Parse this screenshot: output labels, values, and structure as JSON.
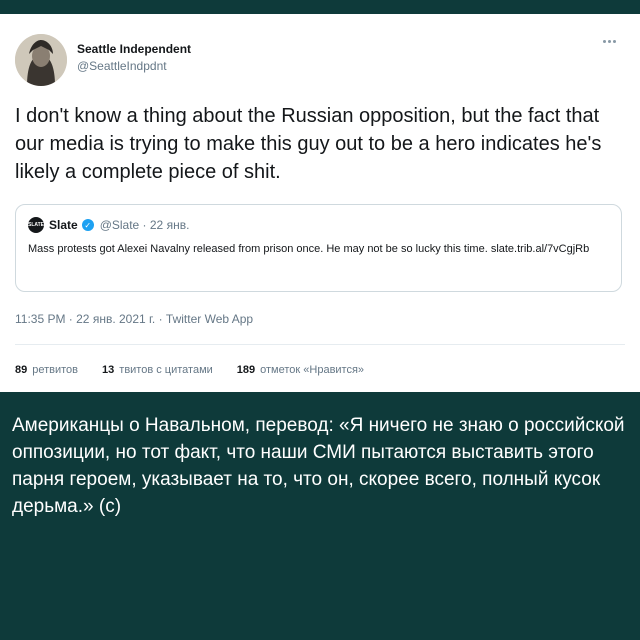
{
  "tweet": {
    "author_name": "Seattle Independent",
    "author_handle": "@SeattleIndpdnt",
    "text": "I don't know a thing about the Russian opposition, but the fact that our media is trying to make this guy out to be a hero indicates he's likely a complete piece of shit.",
    "quote": {
      "logo_text": "SLATE",
      "name": "Slate",
      "handle_date": "@Slate · 22 янв.",
      "text": "Mass protests got Alexei Navalny released from prison once. He may not be so lucky this time. slate.trib.al/7vCgjRb"
    },
    "meta": "11:35 PM · 22 янв. 2021 г. · Twitter Web App",
    "stats": {
      "retweets_count": "89",
      "retweets_label": "ретвитов",
      "quotes_count": "13",
      "quotes_label": "твитов с цитатами",
      "likes_count": "189",
      "likes_label": "отметок «Нравится»"
    }
  },
  "caption": "Американцы о Навальном, перевод: «Я ничего не знаю о российской оппозиции, но тот факт, что наши СМИ пытаются выставить этого парня героем, указывает на то, что он, скорее всего, полный кусок дерьма.» (с)",
  "colors": {
    "caption_bg": "#0e3a3a",
    "accent": "#1da1f2"
  },
  "icons": {
    "verified": "verified-icon",
    "more": "more-icon"
  }
}
